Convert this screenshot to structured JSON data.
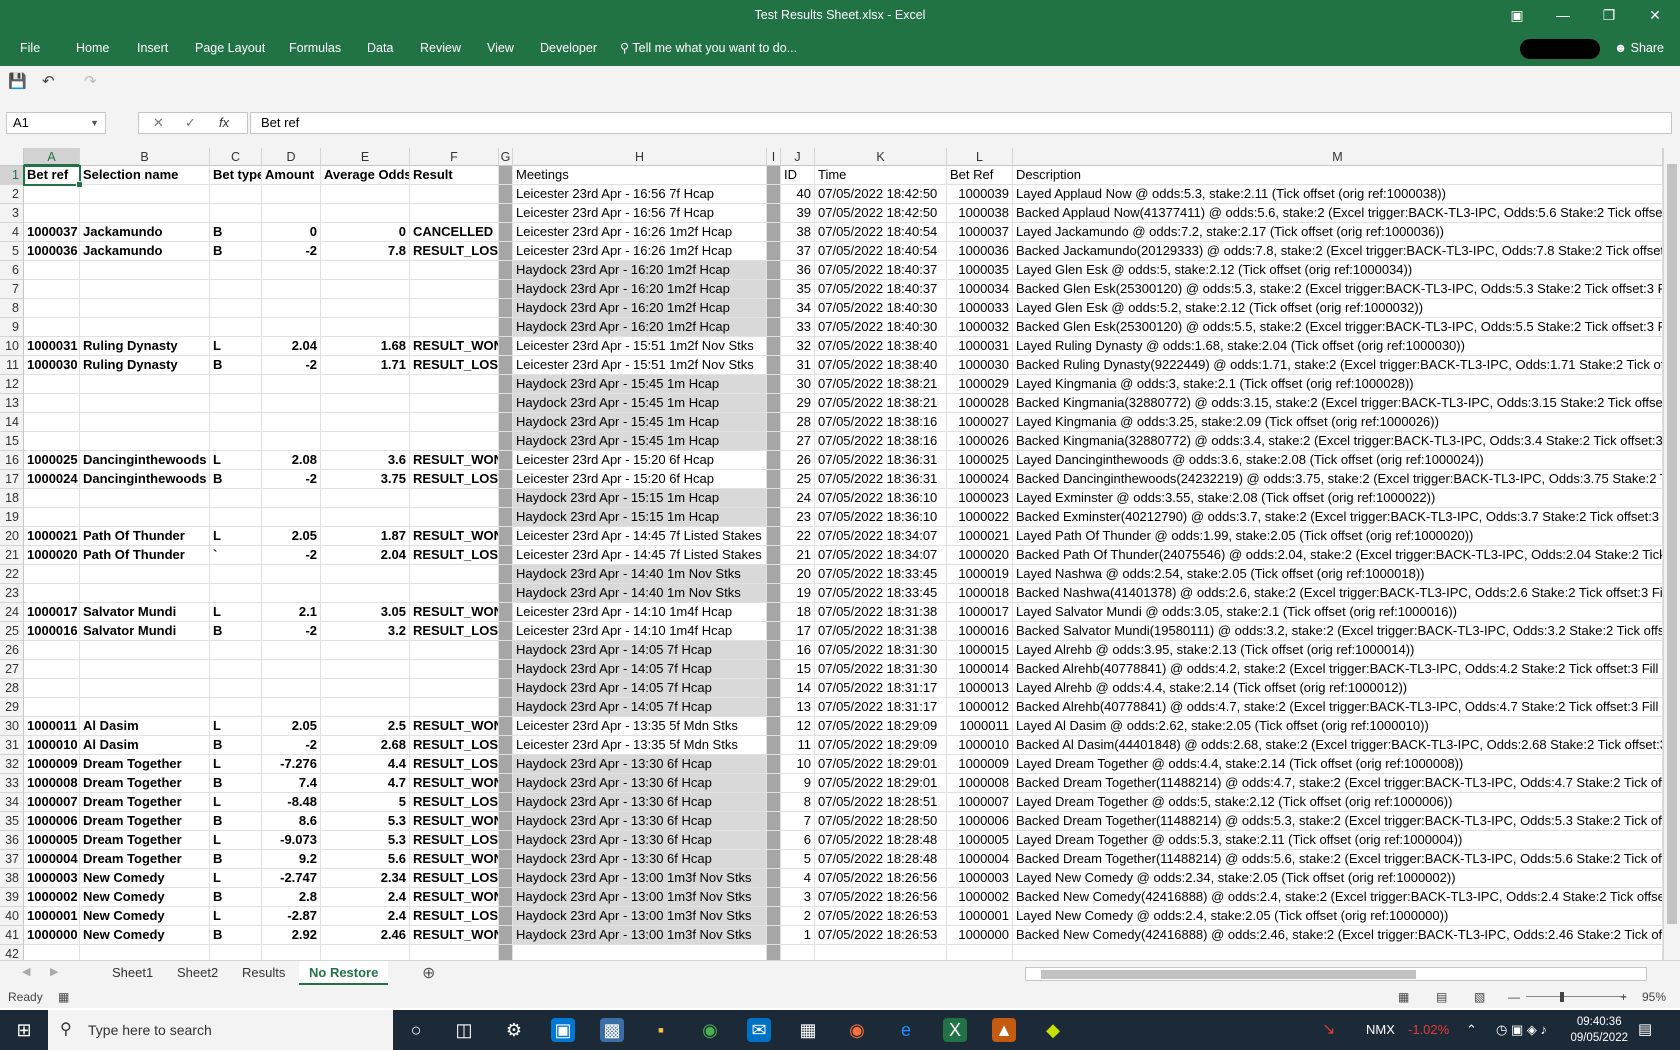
{
  "window": {
    "title": "Test Results Sheet.xlsx - Excel"
  },
  "ribbon": {
    "file": "File",
    "tabs": [
      "Home",
      "Insert",
      "Page Layout",
      "Formulas",
      "Data",
      "Review",
      "View",
      "Developer"
    ],
    "tell_me": "Tell me what you want to do...",
    "share": "Share"
  },
  "formula_bar": {
    "name_box": "A1",
    "value": "Bet ref"
  },
  "columns": [
    "A",
    "B",
    "C",
    "D",
    "E",
    "F",
    "G",
    "H",
    "I",
    "J",
    "K",
    "L",
    "M"
  ],
  "rows": [
    [
      "Bet ref",
      "Selection name",
      "Bet type",
      "Amount",
      "Average Odds",
      "Result",
      "",
      "Meetings",
      "",
      "ID",
      "Time",
      "Bet Ref",
      "Description"
    ],
    [
      "",
      "",
      "",
      "",
      "",
      "",
      "",
      "Leicester 23rd Apr - 16:56 7f Hcap",
      "",
      "40",
      "07/05/2022 18:42:50",
      "1000039",
      "Layed Applaud Now @ odds:5.3, stake:2.11 (Tick offset (orig ref:1000038))"
    ],
    [
      "",
      "",
      "",
      "",
      "",
      "",
      "",
      "Leicester 23rd Apr - 16:56 7f Hcap",
      "",
      "39",
      "07/05/2022 18:42:50",
      "1000038",
      "Backed Applaud Now(41377411) @ odds:5.6, stake:2 (Excel trigger:BACK-TL3-IPC, Odds:5.6 Stake:2 Tick offset:3 Fill or kill"
    ],
    [
      "1000037",
      "Jackamundo",
      "B",
      "0",
      "0",
      "CANCELLED",
      "",
      "Leicester 23rd Apr - 16:26 1m2f Hcap",
      "",
      "38",
      "07/05/2022 18:40:54",
      "1000037",
      "Layed Jackamundo @ odds:7.2, stake:2.17 (Tick offset (orig ref:1000036))"
    ],
    [
      "1000036",
      "Jackamundo",
      "B",
      "-2",
      "7.8",
      "RESULT_LOST",
      "",
      "Leicester 23rd Apr - 16:26 1m2f Hcap",
      "",
      "37",
      "07/05/2022 18:40:54",
      "1000036",
      "Backed Jackamundo(20129333) @ odds:7.8, stake:2 (Excel trigger:BACK-TL3-IPC, Odds:7.8 Stake:2 Tick offset:3 Fill or kill"
    ],
    [
      "",
      "",
      "",
      "",
      "",
      "",
      "",
      "Haydock 23rd Apr - 16:20 1m2f Hcap",
      "",
      "36",
      "07/05/2022 18:40:37",
      "1000035",
      "Layed Glen Esk @ odds:5, stake:2.12 (Tick offset (orig ref:1000034))"
    ],
    [
      "",
      "",
      "",
      "",
      "",
      "",
      "",
      "Haydock 23rd Apr - 16:20 1m2f Hcap",
      "",
      "35",
      "07/05/2022 18:40:37",
      "1000034",
      "Backed Glen Esk(25300120) @ odds:5.3, stake:2 (Excel trigger:BACK-TL3-IPC, Odds:5.3 Stake:2 Tick offset:3 Fill or kill"
    ],
    [
      "",
      "",
      "",
      "",
      "",
      "",
      "",
      "Haydock 23rd Apr - 16:20 1m2f Hcap",
      "",
      "34",
      "07/05/2022 18:40:30",
      "1000033",
      "Layed Glen Esk @ odds:5.2, stake:2.12 (Tick offset (orig ref:1000032))"
    ],
    [
      "",
      "",
      "",
      "",
      "",
      "",
      "",
      "Haydock 23rd Apr - 16:20 1m2f Hcap",
      "",
      "33",
      "07/05/2022 18:40:30",
      "1000032",
      "Backed Glen Esk(25300120) @ odds:5.5, stake:2 (Excel trigger:BACK-TL3-IPC, Odds:5.5 Stake:2 Tick offset:3 Fill or kill"
    ],
    [
      "1000031",
      "Ruling Dynasty",
      "L",
      "2.04",
      "1.68",
      "RESULT_WON",
      "",
      "Leicester 23rd Apr - 15:51 1m2f Nov Stks",
      "",
      "32",
      "07/05/2022 18:38:40",
      "1000031",
      "Layed Ruling Dynasty @ odds:1.68, stake:2.04 (Tick offset (orig ref:1000030))"
    ],
    [
      "1000030",
      "Ruling Dynasty",
      "B",
      "-2",
      "1.71",
      "RESULT_LOST",
      "",
      "Leicester 23rd Apr - 15:51 1m2f Nov Stks",
      "",
      "31",
      "07/05/2022 18:38:40",
      "1000030",
      "Backed Ruling Dynasty(9222449) @ odds:1.71, stake:2 (Excel trigger:BACK-TL3-IPC, Odds:1.71 Stake:2 Tick offset:3"
    ],
    [
      "",
      "",
      "",
      "",
      "",
      "",
      "",
      "Haydock 23rd Apr - 15:45 1m Hcap",
      "",
      "30",
      "07/05/2022 18:38:21",
      "1000029",
      "Layed Kingmania @ odds:3, stake:2.1 (Tick offset (orig ref:1000028))"
    ],
    [
      "",
      "",
      "",
      "",
      "",
      "",
      "",
      "Haydock 23rd Apr - 15:45 1m Hcap",
      "",
      "29",
      "07/05/2022 18:38:21",
      "1000028",
      "Backed Kingmania(32880772) @ odds:3.15, stake:2 (Excel trigger:BACK-TL3-IPC, Odds:3.15 Stake:2 Tick offset:3 Fil"
    ],
    [
      "",
      "",
      "",
      "",
      "",
      "",
      "",
      "Haydock 23rd Apr - 15:45 1m Hcap",
      "",
      "28",
      "07/05/2022 18:38:16",
      "1000027",
      "Layed Kingmania @ odds:3.25, stake:2.09 (Tick offset (orig ref:1000026))"
    ],
    [
      "",
      "",
      "",
      "",
      "",
      "",
      "",
      "Haydock 23rd Apr - 15:45 1m Hcap",
      "",
      "27",
      "07/05/2022 18:38:16",
      "1000026",
      "Backed Kingmania(32880772) @ odds:3.4, stake:2 (Excel trigger:BACK-TL3-IPC, Odds:3.4 Stake:2 Tick offset:3 Fill or"
    ],
    [
      "1000025",
      "Dancinginthewoods",
      "L",
      "2.08",
      "3.6",
      "RESULT_WON",
      "",
      "Leicester 23rd Apr - 15:20 6f Hcap",
      "",
      "26",
      "07/05/2022 18:36:31",
      "1000025",
      "Layed Dancinginthewoods @ odds:3.6, stake:2.08 (Tick offset (orig ref:1000024))"
    ],
    [
      "1000024",
      "Dancinginthewoods",
      "B",
      "-2",
      "3.75",
      "RESULT_LOST",
      "",
      "Leicester 23rd Apr - 15:20 6f Hcap",
      "",
      "25",
      "07/05/2022 18:36:31",
      "1000024",
      "Backed Dancinginthewoods(24232219) @ odds:3.75, stake:2 (Excel trigger:BACK-TL3-IPC, Odds:3.75 Stake:2 Tick o"
    ],
    [
      "",
      "",
      "",
      "",
      "",
      "",
      "",
      "Haydock 23rd Apr - 15:15 1m Hcap",
      "",
      "24",
      "07/05/2022 18:36:10",
      "1000023",
      "Layed Exminster @ odds:3.55, stake:2.08 (Tick offset (orig ref:1000022))"
    ],
    [
      "",
      "",
      "",
      "",
      "",
      "",
      "",
      "Haydock 23rd Apr - 15:15 1m Hcap",
      "",
      "23",
      "07/05/2022 18:36:10",
      "1000022",
      "Backed Exminster(40212790) @ odds:3.7, stake:2 (Excel trigger:BACK-TL3-IPC, Odds:3.7 Stake:2 Tick offset:3 Fill or"
    ],
    [
      "1000021",
      "Path Of Thunder",
      "L",
      "2.05",
      "1.87",
      "RESULT_WON",
      "",
      "Leicester 23rd Apr - 14:45 7f Listed Stakes",
      "",
      "22",
      "07/05/2022 18:34:07",
      "1000021",
      "Layed Path Of Thunder @ odds:1.99, stake:2.05 (Tick offset (orig ref:1000020))"
    ],
    [
      "1000020",
      "Path Of Thunder",
      "`",
      "-2",
      "2.04",
      "RESULT_LOST",
      "",
      "Leicester 23rd Apr - 14:45 7f Listed Stakes",
      "",
      "21",
      "07/05/2022 18:34:07",
      "1000020",
      "Backed Path Of Thunder(24075546) @ odds:2.04, stake:2 (Excel trigger:BACK-TL3-IPC, Odds:2.04 Stake:2 Tick offse"
    ],
    [
      "",
      "",
      "",
      "",
      "",
      "",
      "",
      "Haydock 23rd Apr - 14:40 1m Nov Stks",
      "",
      "20",
      "07/05/2022 18:33:45",
      "1000019",
      "Layed Nashwa @ odds:2.54, stake:2.05 (Tick offset (orig ref:1000018))"
    ],
    [
      "",
      "",
      "",
      "",
      "",
      "",
      "",
      "Haydock 23rd Apr - 14:40 1m Nov Stks",
      "",
      "19",
      "07/05/2022 18:33:45",
      "1000018",
      "Backed Nashwa(41401378) @ odds:2.6, stake:2 (Excel trigger:BACK-TL3-IPC, Odds:2.6 Stake:2 Tick offset:3 Fill or ki"
    ],
    [
      "1000017",
      "Salvator Mundi",
      "L",
      "2.1",
      "3.05",
      "RESULT_WON",
      "",
      "Leicester 23rd Apr - 14:10 1m4f Hcap",
      "",
      "18",
      "07/05/2022 18:31:38",
      "1000017",
      "Layed Salvator Mundi @ odds:3.05, stake:2.1 (Tick offset (orig ref:1000016))"
    ],
    [
      "1000016",
      "Salvator Mundi",
      "B",
      "-2",
      "3.2",
      "RESULT_LOST",
      "",
      "Leicester 23rd Apr - 14:10 1m4f Hcap",
      "",
      "17",
      "07/05/2022 18:31:38",
      "1000016",
      "Backed Salvator Mundi(19580111) @ odds:3.2, stake:2 (Excel trigger:BACK-TL3-IPC, Odds:3.2 Stake:2 Tick offset:3"
    ],
    [
      "",
      "",
      "",
      "",
      "",
      "",
      "",
      "Haydock 23rd Apr - 14:05 7f Hcap",
      "",
      "16",
      "07/05/2022 18:31:30",
      "1000015",
      "Layed Alrehb @ odds:3.95, stake:2.13 (Tick offset (orig ref:1000014))"
    ],
    [
      "",
      "",
      "",
      "",
      "",
      "",
      "",
      "Haydock 23rd Apr - 14:05 7f Hcap",
      "",
      "15",
      "07/05/2022 18:31:30",
      "1000014",
      "Backed Alrehb(40778841) @ odds:4.2, stake:2 (Excel trigger:BACK-TL3-IPC, Odds:4.2 Stake:2 Tick offset:3 Fill or kill"
    ],
    [
      "",
      "",
      "",
      "",
      "",
      "",
      "",
      "Haydock 23rd Apr - 14:05 7f Hcap",
      "",
      "14",
      "07/05/2022 18:31:17",
      "1000013",
      "Layed Alrehb @ odds:4.4, stake:2.14 (Tick offset (orig ref:1000012))"
    ],
    [
      "",
      "",
      "",
      "",
      "",
      "",
      "",
      "Haydock 23rd Apr - 14:05 7f Hcap",
      "",
      "13",
      "07/05/2022 18:31:17",
      "1000012",
      "Backed Alrehb(40778841) @ odds:4.7, stake:2 (Excel trigger:BACK-TL3-IPC, Odds:4.7 Stake:2 Tick offset:3 Fill or kill"
    ],
    [
      "1000011",
      "Al Dasim",
      "L",
      "2.05",
      "2.5",
      "RESULT_WON",
      "",
      "Leicester 23rd Apr - 13:35 5f Mdn Stks",
      "",
      "12",
      "07/05/2022 18:29:09",
      "1000011",
      "Layed Al Dasim @ odds:2.62, stake:2.05 (Tick offset (orig ref:1000010))"
    ],
    [
      "1000010",
      "Al Dasim",
      "B",
      "-2",
      "2.68",
      "RESULT_LOST",
      "",
      "Leicester 23rd Apr - 13:35 5f Mdn Stks",
      "",
      "11",
      "07/05/2022 18:29:09",
      "1000010",
      "Backed Al Dasim(44401848) @ odds:2.68, stake:2 (Excel trigger:BACK-TL3-IPC, Odds:2.68 Stake:2 Tick offset:3 Fill o"
    ],
    [
      "1000009",
      "Dream Together",
      "L",
      "-7.276",
      "4.4",
      "RESULT_LOST",
      "",
      "Haydock 23rd Apr - 13:30 6f Hcap",
      "",
      "10",
      "07/05/2022 18:29:01",
      "1000009",
      "Layed Dream Together @ odds:4.4, stake:2.14 (Tick offset (orig ref:1000008))"
    ],
    [
      "1000008",
      "Dream Together",
      "B",
      "7.4",
      "4.7",
      "RESULT_WON",
      "",
      "Haydock 23rd Apr - 13:30 6f Hcap",
      "",
      "9",
      "07/05/2022 18:29:01",
      "1000008",
      "Backed Dream Together(11488214) @ odds:4.7, stake:2 (Excel trigger:BACK-TL3-IPC, Odds:4.7 Stake:2 Tick offset:"
    ],
    [
      "1000007",
      "Dream Together",
      "L",
      "-8.48",
      "5",
      "RESULT_LOST",
      "",
      "Haydock 23rd Apr - 13:30 6f Hcap",
      "",
      "8",
      "07/05/2022 18:28:51",
      "1000007",
      "Layed Dream Together @ odds:5, stake:2.12 (Tick offset (orig ref:1000006))"
    ],
    [
      "1000006",
      "Dream Together",
      "B",
      "8.6",
      "5.3",
      "RESULT_WON",
      "",
      "Haydock 23rd Apr - 13:30 6f Hcap",
      "",
      "7",
      "07/05/2022 18:28:50",
      "1000006",
      "Backed Dream Together(11488214) @ odds:5.3, stake:2 (Excel trigger:BACK-TL3-IPC, Odds:5.3 Stake:2 Tick offset:"
    ],
    [
      "1000005",
      "Dream Together",
      "L",
      "-9.073",
      "5.3",
      "RESULT_LOST",
      "",
      "Haydock 23rd Apr - 13:30 6f Hcap",
      "",
      "6",
      "07/05/2022 18:28:48",
      "1000005",
      "Layed Dream Together @ odds:5.3, stake:2.11 (Tick offset (orig ref:1000004))"
    ],
    [
      "1000004",
      "Dream Together",
      "B",
      "9.2",
      "5.6",
      "RESULT_WON",
      "",
      "Haydock 23rd Apr - 13:30 6f Hcap",
      "",
      "5",
      "07/05/2022 18:28:48",
      "1000004",
      "Backed Dream Together(11488214) @ odds:5.6, stake:2 (Excel trigger:BACK-TL3-IPC, Odds:5.6 Stake:2 Tick offset:"
    ],
    [
      "1000003",
      "New Comedy",
      "L",
      "-2.747",
      "2.34",
      "RESULT_LOST",
      "",
      "Haydock 23rd Apr - 13:00 1m3f Nov Stks",
      "",
      "4",
      "07/05/2022 18:26:56",
      "1000003",
      "Layed New Comedy @ odds:2.34, stake:2.05 (Tick offset (orig ref:1000002))"
    ],
    [
      "1000002",
      "New Comedy",
      "B",
      "2.8",
      "2.4",
      "RESULT_WON",
      "",
      "Haydock 23rd Apr - 13:00 1m3f Nov Stks",
      "",
      "3",
      "07/05/2022 18:26:56",
      "1000002",
      "Backed New Comedy(42416888) @ odds:2.4, stake:2 (Excel trigger:BACK-TL3-IPC, Odds:2.4 Stake:2 Tick offset:3 Fil"
    ],
    [
      "1000001",
      "New Comedy",
      "L",
      "-2.87",
      "2.4",
      "RESULT_LOST",
      "",
      "Haydock 23rd Apr - 13:00 1m3f Nov Stks",
      "",
      "2",
      "07/05/2022 18:26:53",
      "1000001",
      "Layed New Comedy @ odds:2.4, stake:2.05 (Tick offset (orig ref:1000000))"
    ],
    [
      "1000000",
      "New Comedy",
      "B",
      "2.92",
      "2.46",
      "RESULT_WON",
      "",
      "Haydock 23rd Apr - 13:00 1m3f Nov Stks",
      "",
      "1",
      "07/05/2022 18:26:53",
      "1000000",
      "Backed New Comedy(42416888) @ odds:2.46, stake:2 (Excel trigger:BACK-TL3-IPC, Odds:2.46 Stake:2 Tick offset:3"
    ],
    [
      "",
      "",
      "",
      "",
      "",
      "",
      "",
      "",
      "",
      "",
      "",
      "",
      ""
    ]
  ],
  "sheet_tabs": [
    "Sheet1",
    "Sheet2",
    "Results",
    "No Restore"
  ],
  "active_sheet": "No Restore",
  "status": {
    "ready": "Ready",
    "zoom": "95%"
  },
  "taskbar": {
    "search_placeholder": "Type here to search",
    "ticker": "NMX",
    "ticker_change": "-1.02%",
    "time": "09:40:36",
    "date": "09/05/2022"
  },
  "colors": {
    "excel_green": "#217346",
    "gray_fill": "#d9d9d9",
    "dark_fill": "#a6a6a6"
  }
}
